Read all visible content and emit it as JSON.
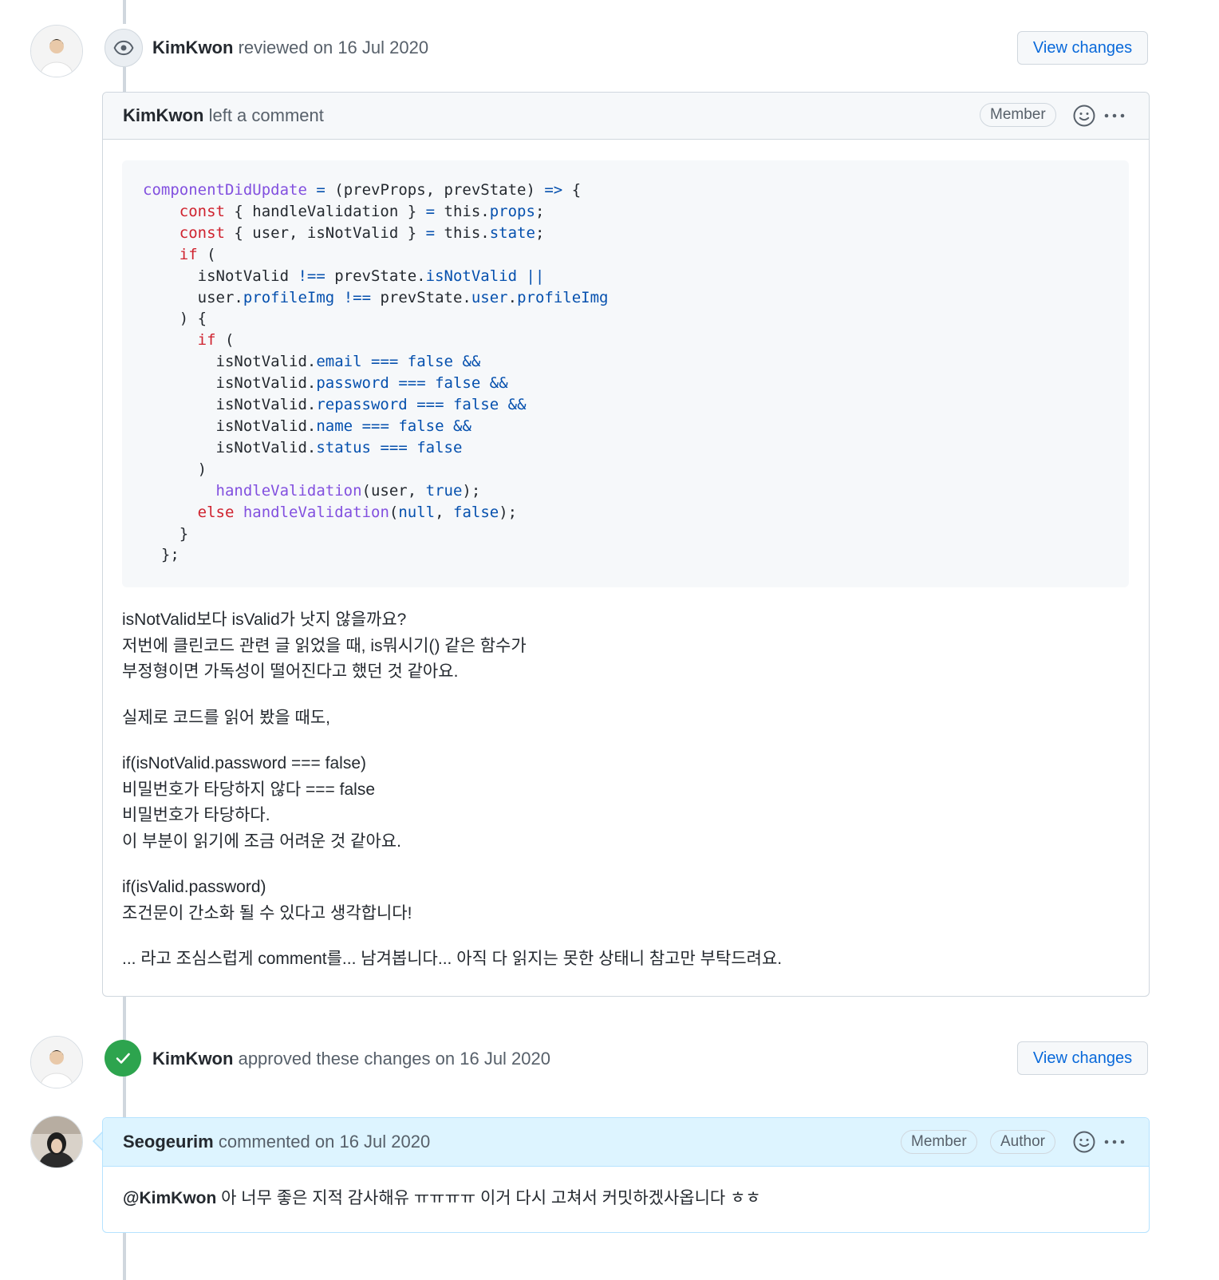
{
  "review_event": {
    "user": "KimKwon",
    "action": "reviewed on 16 Jul 2020",
    "view_changes": "View changes"
  },
  "review_comment": {
    "user": "KimKwon",
    "action": "left a comment",
    "label": "Member",
    "paragraphs": [
      [
        "isNotValid보다 isValid가 낫지 않을까요?",
        "저번에 클린코드 관련 글 읽었을 때, is뭐시기() 같은 함수가",
        "부정형이면 가독성이 떨어진다고 했던 것 같아요."
      ],
      [
        "실제로 코드를 읽어 봤을 때도,"
      ],
      [
        "if(isNotValid.password === false)",
        "비밀번호가 타당하지 않다 === false",
        "비밀번호가 타당하다.",
        "이 부분이 읽기에 조금 어려운 것 같아요."
      ],
      [
        "if(isValid.password)",
        "조건문이 간소화 될 수 있다고 생각합니다!"
      ],
      [
        "... 라고 조심스럽게 comment를... 남겨봅니다... 아직 다 읽지는 못한 상태니 참고만 부탁드려요."
      ]
    ]
  },
  "approve_event": {
    "user": "KimKwon",
    "action": "approved these changes on 16 Jul 2020",
    "view_changes": "View changes"
  },
  "reply_comment": {
    "user": "Seogeurim",
    "action": "commented on 16 Jul 2020",
    "labels": [
      "Member",
      "Author"
    ],
    "mention": "@KimKwon",
    "text": " 아 너무 좋은 지적 감사해유 ㅠㅠㅠㅠ 이거 다시 고쳐서 커밋하겠사옵니다 ㅎㅎ"
  },
  "icons": {
    "review": "eye-icon",
    "approve": "check-icon",
    "reaction": "smiley-icon",
    "menu": "kebab-horizontal-icon"
  },
  "colors": {
    "approve_green": "#2da44e",
    "link_blue": "#0969da",
    "author_header": "#ddf4ff"
  }
}
